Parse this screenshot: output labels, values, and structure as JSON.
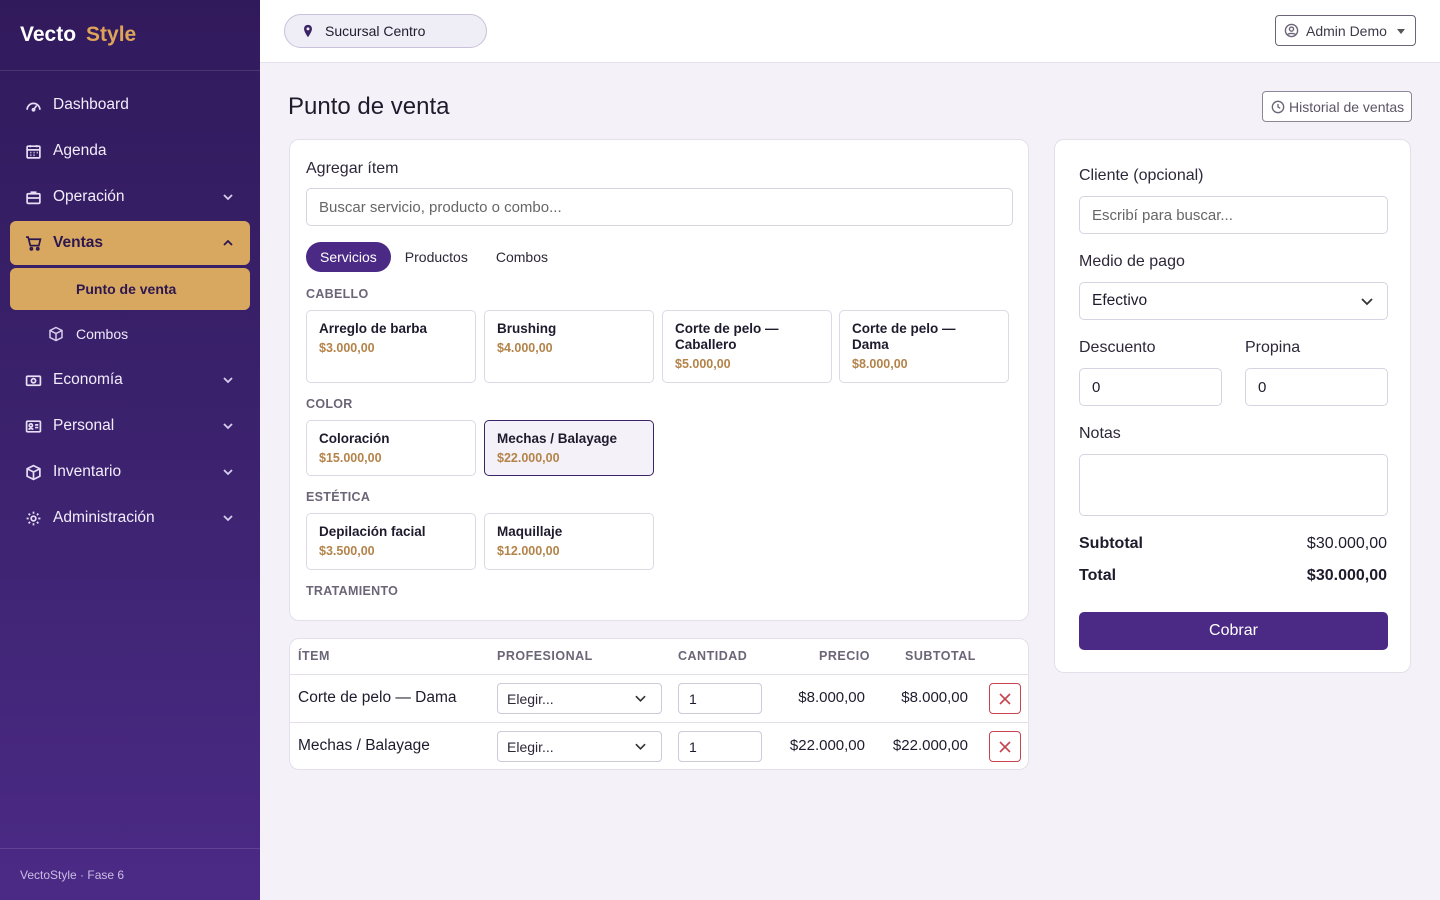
{
  "brand": {
    "part1": "Vecto",
    "part2": "Style"
  },
  "sidebar": {
    "items": [
      {
        "label": "Dashboard",
        "icon": "gauge-icon"
      },
      {
        "label": "Agenda",
        "icon": "calendar-icon"
      },
      {
        "label": "Operación",
        "icon": "briefcase-icon"
      },
      {
        "label": "Ventas",
        "icon": "cart-icon"
      },
      {
        "label": "Economía",
        "icon": "cash-icon"
      },
      {
        "label": "Personal",
        "icon": "id-card-icon"
      },
      {
        "label": "Inventario",
        "icon": "box-icon"
      },
      {
        "label": "Administración",
        "icon": "gear-icon"
      }
    ],
    "sub_items": [
      {
        "label": "Punto de venta"
      },
      {
        "label": "Combos",
        "icon": "box-icon"
      }
    ],
    "footer": "VectoStyle · Fase 6"
  },
  "topbar": {
    "branch": "Sucursal Centro",
    "user": "Admin Demo"
  },
  "page": {
    "title": "Punto de venta",
    "history_button": "Historial de ventas"
  },
  "add_item": {
    "label": "Agregar ítem",
    "search_placeholder": "Buscar servicio, producto o combo...",
    "tabs": [
      "Servicios",
      "Productos",
      "Combos"
    ],
    "active_tab": "Servicios",
    "categories": [
      {
        "name": "CABELLO",
        "items": [
          {
            "name": "Arreglo de barba",
            "price": "$3.000,00"
          },
          {
            "name": "Brushing",
            "price": "$4.000,00"
          },
          {
            "name": "Corte de pelo — Caballero",
            "price": "$5.000,00"
          },
          {
            "name": "Corte de pelo — Dama",
            "price": "$8.000,00"
          }
        ]
      },
      {
        "name": "COLOR",
        "items": [
          {
            "name": "Coloración",
            "price": "$15.000,00"
          },
          {
            "name": "Mechas / Balayage",
            "price": "$22.000,00"
          }
        ]
      },
      {
        "name": "ESTÉTICA",
        "items": [
          {
            "name": "Depilación facial",
            "price": "$3.500,00"
          },
          {
            "name": "Maquillaje",
            "price": "$12.000,00"
          }
        ]
      },
      {
        "name": "TRATAMIENTO",
        "items": []
      }
    ]
  },
  "cart": {
    "columns": [
      "ÍTEM",
      "PROFESIONAL",
      "CANTIDAD",
      "PRECIO",
      "SUBTOTAL"
    ],
    "rows": [
      {
        "item": "Corte de pelo — Dama",
        "professional": "Elegir...",
        "qty": "1",
        "price": "$8.000,00",
        "subtotal": "$8.000,00"
      },
      {
        "item": "Mechas / Balayage",
        "professional": "Elegir...",
        "qty": "1",
        "price": "$22.000,00",
        "subtotal": "$22.000,00"
      }
    ]
  },
  "payment": {
    "client_label": "Cliente (opcional)",
    "client_placeholder": "Escribí para buscar...",
    "method_label": "Medio de pago",
    "method_value": "Efectivo",
    "discount_label": "Descuento",
    "discount_value": "0",
    "tip_label": "Propina",
    "tip_value": "0",
    "notes_label": "Notas",
    "subtotal_label": "Subtotal",
    "subtotal_value": "$30.000,00",
    "total_label": "Total",
    "total_value": "$30.000,00",
    "charge_button": "Cobrar"
  },
  "colors": {
    "primary": "#4b2a86",
    "accent": "#d9a860",
    "price": "#b4834a",
    "danger": "#c9434f"
  }
}
